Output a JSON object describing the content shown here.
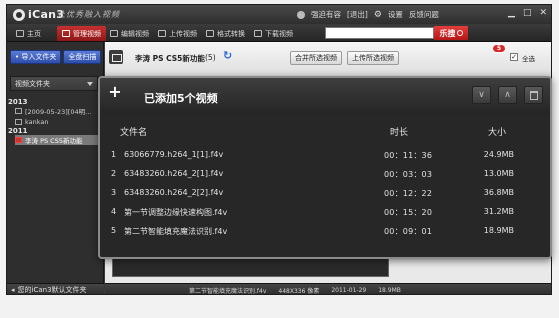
{
  "app": {
    "logo_text": "iCan3",
    "slogan": "让优秀融入视频",
    "user_label": "强迫有容",
    "logout_label": "[退出]",
    "settings_label": "设置",
    "feedback_label": "反馈问题"
  },
  "nav": {
    "tabs": [
      {
        "label": "主页"
      },
      {
        "label": "管理视频"
      },
      {
        "label": "编辑视频"
      },
      {
        "label": "上传视频"
      },
      {
        "label": "格式转换"
      },
      {
        "label": "下载视频"
      }
    ],
    "search_button_label": "乐搜"
  },
  "sidebar": {
    "import_button": "• 导入文件夹",
    "scan_button": "全盘扫描",
    "header": "视频文件夹",
    "groups": [
      {
        "year": "2013",
        "items": [
          "[2009-05-23][04明...",
          "kankan"
        ]
      },
      {
        "year": "2011",
        "items": [
          "李涛 PS CS5新功能"
        ]
      }
    ],
    "footer": "您的iCan3默认文件夹"
  },
  "main": {
    "folder_title": "李涛 PS CS5新功能",
    "folder_count": "(5)",
    "merge_button": "合并所选视频",
    "upload_button": "上传所选视频",
    "upload_badge": "5",
    "select_all_label": "全选",
    "select_all_checked": true
  },
  "status": {
    "file": "第二节智能填充魔法识别.f4v",
    "pixels": "448X336 像素",
    "date": "2011-01-29",
    "size": "18.9MB"
  },
  "popup": {
    "title": "已添加5个视频",
    "columns": {
      "name": "文件名",
      "duration": "时长",
      "size": "大小"
    },
    "rows": [
      {
        "no": "1",
        "name": "63066779.h264_1[1].f4v",
        "duration": "00：11：36",
        "size": "24.9MB"
      },
      {
        "no": "2",
        "name": "63483260.h264_2[1].f4v",
        "duration": "00：03：03",
        "size": "13.0MB"
      },
      {
        "no": "3",
        "name": "63483260.h264_2[2].f4v",
        "duration": "00：12：22",
        "size": "36.8MB"
      },
      {
        "no": "4",
        "name": "第一节调整边缘快速构图.f4v",
        "duration": "00：15：20",
        "size": "31.2MB"
      },
      {
        "no": "5",
        "name": "第二节智能填充魔法识别.f4v",
        "duration": "00：09：01",
        "size": "18.9MB"
      }
    ]
  }
}
